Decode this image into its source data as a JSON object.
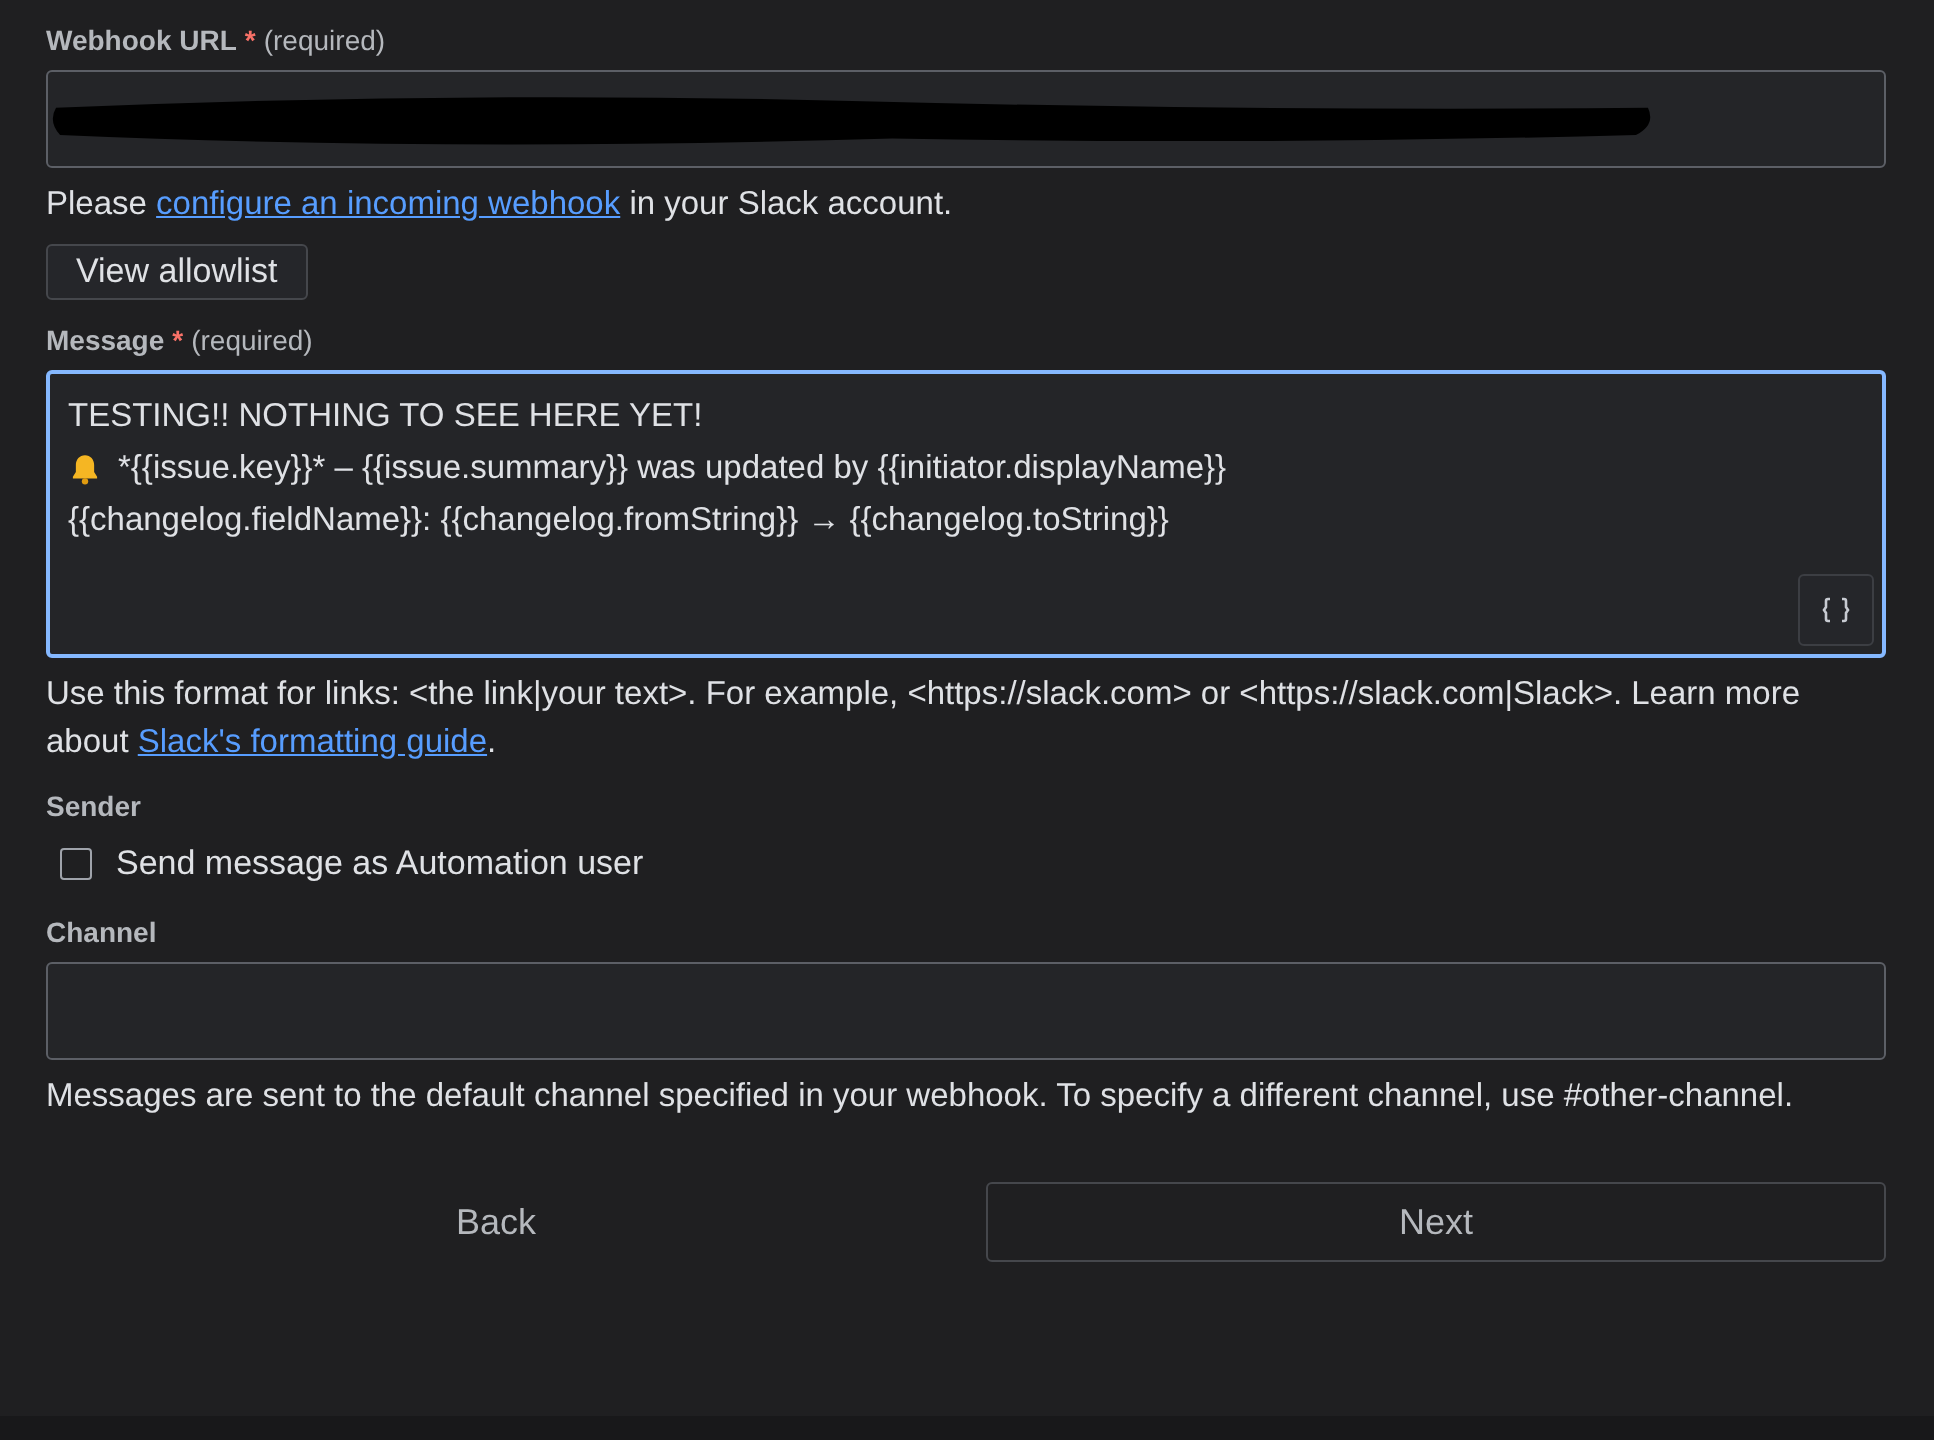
{
  "webhook": {
    "label": "Webhook URL",
    "required_mark": "*",
    "required_text": "(required)",
    "redacted": true,
    "hint": [
      {
        "text": "Please "
      },
      {
        "text": "configure an incoming webhook",
        "link": true
      },
      {
        "text": " in your Slack account."
      }
    ],
    "allowlist_button": "View allowlist"
  },
  "message": {
    "label": "Message",
    "required_mark": "*",
    "required_text": "(required)",
    "focused": true,
    "lines": [
      {
        "kind": "plain",
        "text": "TESTING!! NOTHING TO SEE HERE YET!"
      },
      {
        "kind": "bell",
        "text": "*{{issue.key}}* – {{issue.summary}} was updated by {{initiator.displayName}}"
      },
      {
        "kind": "plain",
        "text": "{{changelog.fieldName}}: {{changelog.fromString}} → {{changelog.toString}}"
      }
    ],
    "hint": [
      {
        "text": "Use this format for links: <the link|your text>. For example, <https://slack.com> or <https://slack.com|Slack>. Learn more about "
      },
      {
        "text": "Slack's formatting guide",
        "link": true
      },
      {
        "text": "."
      }
    ]
  },
  "sender": {
    "label": "Sender",
    "option": {
      "label": "Send message as Automation user",
      "checked": false
    }
  },
  "channel": {
    "label": "Channel",
    "hint": [
      {
        "text": "Messages are sent to the default channel specified in your webhook. To specify a different channel, use #other-channel."
      }
    ]
  },
  "buttons": [
    {
      "label": "Back",
      "kind": "subtle"
    },
    {
      "label": "Next",
      "kind": "outline"
    }
  ]
}
